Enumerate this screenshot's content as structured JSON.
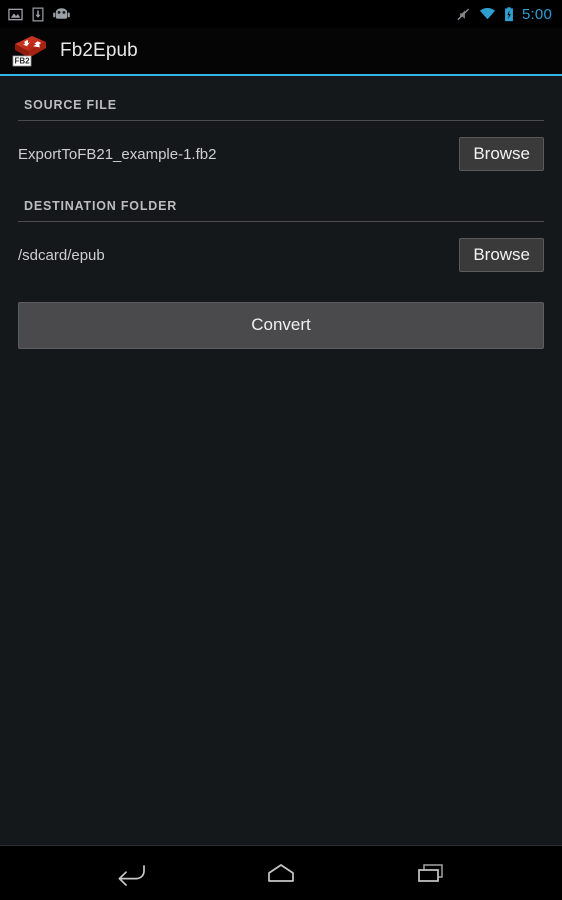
{
  "status_bar": {
    "icons_left": [
      {
        "name": "screenshot-icon",
        "label": "screenshot"
      },
      {
        "name": "download-icon",
        "label": "download"
      },
      {
        "name": "android-usb-icon",
        "label": "android-debug"
      }
    ],
    "icons_right": [
      {
        "name": "silent-mode-icon",
        "label": "silent"
      },
      {
        "name": "wifi-icon",
        "label": "wifi"
      },
      {
        "name": "battery-charging-icon",
        "label": "battery"
      }
    ],
    "time": "5:00",
    "time_color": "#2f9fd0"
  },
  "action_bar": {
    "app_icon_name": "fb2epub-app-icon",
    "app_icon_badge": "FB2",
    "title": "Fb2Epub",
    "accent_color": "#33b5e5"
  },
  "main": {
    "sections": [
      {
        "header": "SOURCE FILE",
        "value": "ExportToFB21_example-1.fb2",
        "button_label": "Browse"
      },
      {
        "header": "DESTINATION FOLDER",
        "value": "/sdcard/epub",
        "button_label": "Browse"
      }
    ],
    "convert_label": "Convert"
  },
  "nav_bar": {
    "back_label": "Back",
    "home_label": "Home",
    "recents_label": "Recent apps"
  }
}
